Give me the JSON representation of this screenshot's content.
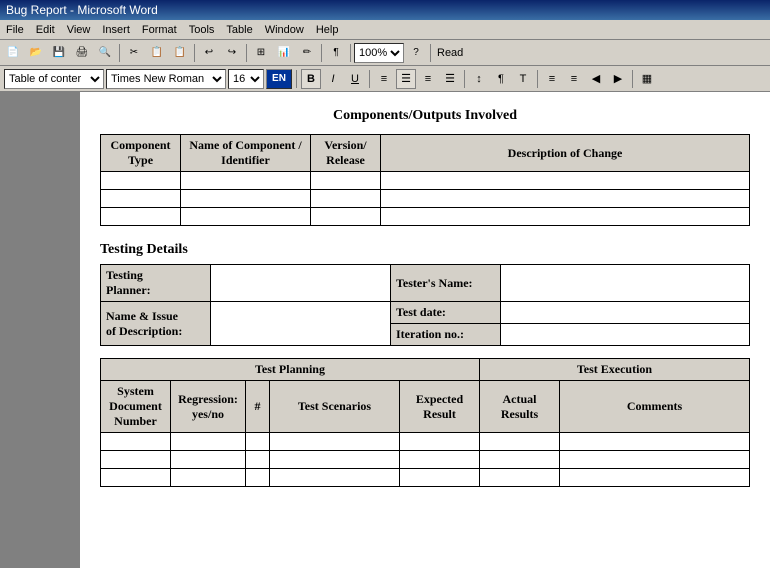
{
  "titleBar": {
    "text": "Bug Report - Microsoft Word"
  },
  "menuBar": {
    "items": [
      "File",
      "Edit",
      "View",
      "Insert",
      "Format",
      "Tools",
      "Table",
      "Window",
      "Help"
    ]
  },
  "toolbar": {
    "buttons": [
      "📄",
      "📂",
      "💾",
      "🖨",
      "🔍",
      "✂",
      "📋",
      "📋",
      "↩",
      "↪",
      "🔍",
      "🔍",
      "📊",
      "📊",
      "📊",
      "📊",
      "📊",
      "📊",
      "📊",
      "📊",
      "📊",
      "📊",
      "📊",
      "📊",
      "¶",
      "T",
      "100%",
      "%",
      "?",
      "📖",
      "Read"
    ]
  },
  "formatBar": {
    "style": "Table of conter",
    "font": "Times New Roman",
    "size": "16",
    "lang": "EN",
    "bold": true,
    "italic": false,
    "underline": false,
    "alignButtons": [
      "◀",
      "▶",
      "◀",
      "▶",
      "▶"
    ],
    "zoom": "100%"
  },
  "components": {
    "sectionTitle": "Components/Outputs Involved",
    "tableHeaders": [
      "Component Type",
      "Name of Component / Identifier",
      "Version/ Release",
      "Description of Change"
    ],
    "emptyRows": 3
  },
  "testing": {
    "sectionTitle": "Testing Details",
    "fields": [
      {
        "label": "Testing Planner:",
        "value": ""
      },
      {
        "label": "Name & Issue of Description:",
        "value": ""
      },
      {
        "label": "Tester's Name:",
        "value": ""
      },
      {
        "label": "Test date:",
        "value": ""
      },
      {
        "label": "Iteration no.:",
        "value": ""
      }
    ]
  },
  "testPlan": {
    "planningHeader": "Test Planning",
    "executionHeader": "Test Execution",
    "columns": [
      {
        "label": "System Document Number"
      },
      {
        "label": "Regression: yes/no"
      },
      {
        "label": "#"
      },
      {
        "label": "Test Scenarios"
      },
      {
        "label": "Expected Result"
      },
      {
        "label": "Actual Results"
      },
      {
        "label": "Comments"
      }
    ],
    "emptyRows": 3
  }
}
